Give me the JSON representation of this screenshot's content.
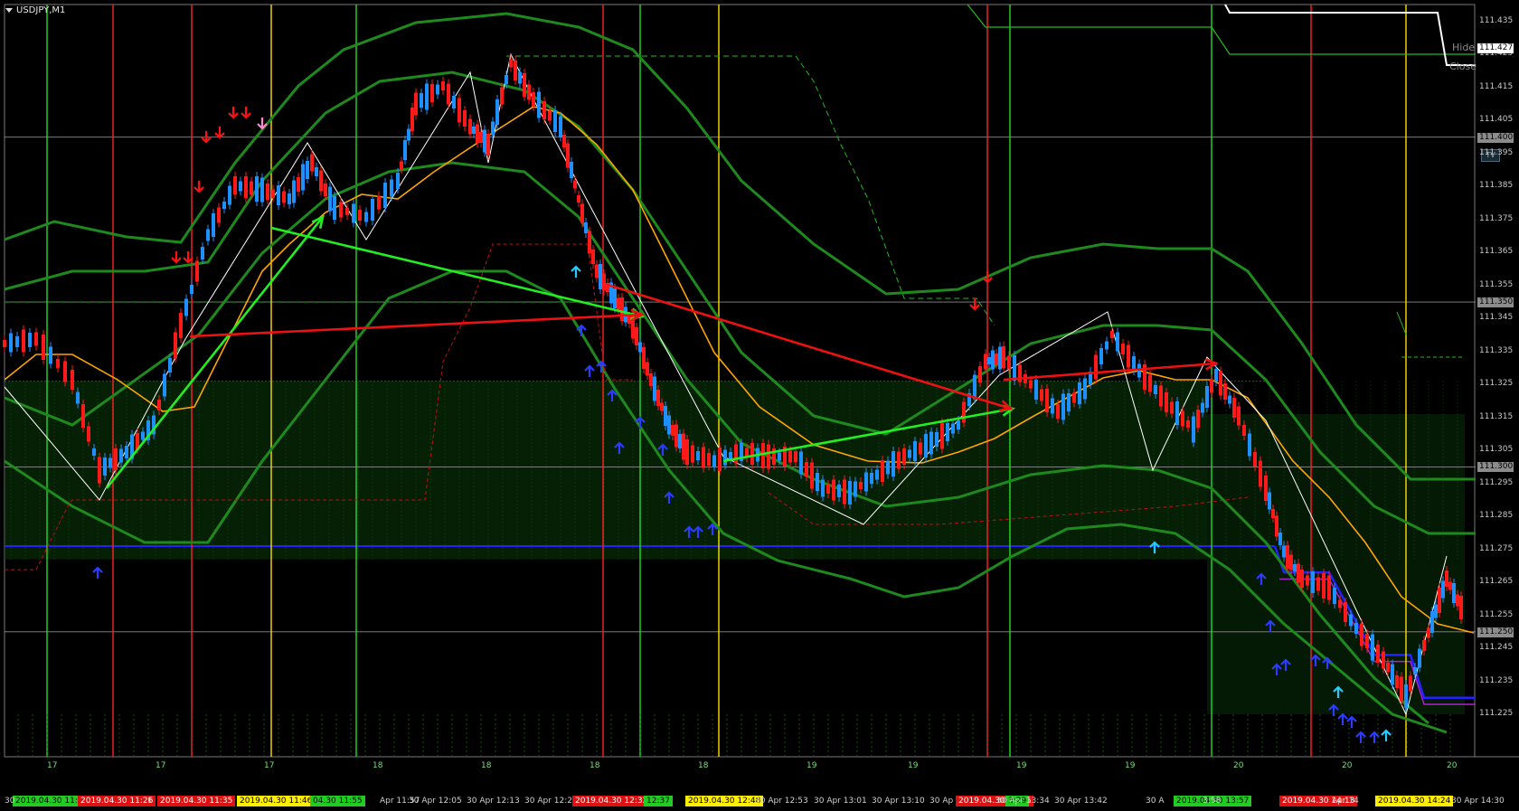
{
  "window": {
    "title": "USDJPY,M1"
  },
  "buttons": {
    "hide": "Hide",
    "close": "Close",
    "tv": "TV"
  },
  "colors": {
    "background": "#000000",
    "bull_candle": "#1e90ff",
    "bear_candle": "#ff1a1a",
    "bands": "#1e8a1e",
    "ma": "#ffa500",
    "zigzag": "#ffffff",
    "green_arrow": "#22ee22",
    "red_arrow": "#ee1111",
    "support_line": "#2222ff",
    "vline_red": "#ff2222",
    "vline_green": "#22dd22",
    "vline_yellow": "#ffdd00"
  },
  "price_axis": {
    "ticks": [
      "111.435",
      "111.425",
      "111.415",
      "111.405",
      "111.395",
      "111.385",
      "111.375",
      "111.365",
      "111.355",
      "111.345",
      "111.335",
      "111.325",
      "111.315",
      "111.305",
      "111.295",
      "111.285",
      "111.275",
      "111.265",
      "111.255",
      "111.245",
      "111.235",
      "111.225"
    ],
    "boxes": [
      {
        "price": "111.427",
        "bg": "#ffffff",
        "fg": "#000000"
      },
      {
        "price": "111.400",
        "bg": "#8c8c8c",
        "fg": "#000000"
      },
      {
        "price": "111.350",
        "bg": "#8c8c8c",
        "fg": "#000000"
      },
      {
        "price": "111.300",
        "bg": "#8c8c8c",
        "fg": "#000000"
      },
      {
        "price": "111.250",
        "bg": "#8c8c8c",
        "fg": "#000000"
      }
    ]
  },
  "day_markers": [
    "17",
    "17",
    "17",
    "18",
    "18",
    "18",
    "18",
    "19",
    "19",
    "19",
    "19",
    "20",
    "20",
    "20"
  ],
  "time_axis": {
    "tags": [
      {
        "text": "2019.04.30 11:1",
        "bg": "#22cc22",
        "fg": "#000000"
      },
      {
        "text": "2019.04.30 11:26",
        "bg": "#dd1111",
        "fg": "#ffffff"
      },
      {
        "text": "2019.04.30 11:35",
        "bg": "#dd1111",
        "fg": "#ffffff"
      },
      {
        "text": "2019.04.30 11:46",
        "bg": "#ffee00",
        "fg": "#000000"
      },
      {
        "text": "04.30 11:55",
        "bg": "#22cc22",
        "fg": "#000000"
      },
      {
        "text": "2019.04.30 12:32",
        "bg": "#dd1111",
        "fg": "#ffffff"
      },
      {
        "text": "12:37",
        "bg": "#22cc22",
        "fg": "#000000"
      },
      {
        "text": "2019.04.30 12:48",
        "bg": "#ffee00",
        "fg": "#000000"
      },
      {
        "text": "2019.04.30 13:26",
        "bg": "#dd1111",
        "fg": "#ffffff"
      },
      {
        "text": "3:29",
        "bg": "#22cc22",
        "fg": "#000000"
      },
      {
        "text": "2019.04.30 13:57",
        "bg": "#22cc22",
        "fg": "#000000"
      },
      {
        "text": "2019.04.30 14:13",
        "bg": "#dd1111",
        "fg": "#ffffff"
      },
      {
        "text": "2019.04.30 14:24",
        "bg": "#ffee00",
        "fg": "#000000"
      }
    ],
    "plain": [
      "30",
      "1",
      "Apr 11:57",
      "30 Apr 12:05",
      "30 Apr 12:13",
      "30 Apr 12:2",
      "30 Apr 12:53",
      "30 Apr 13:01",
      "30 Apr 13:10",
      "30 Ap",
      "30 Apr 13:34",
      "30 Apr 13:42",
      "30 A",
      "3:58",
      "Apr 14",
      "30 Apr 14:30"
    ]
  }
}
